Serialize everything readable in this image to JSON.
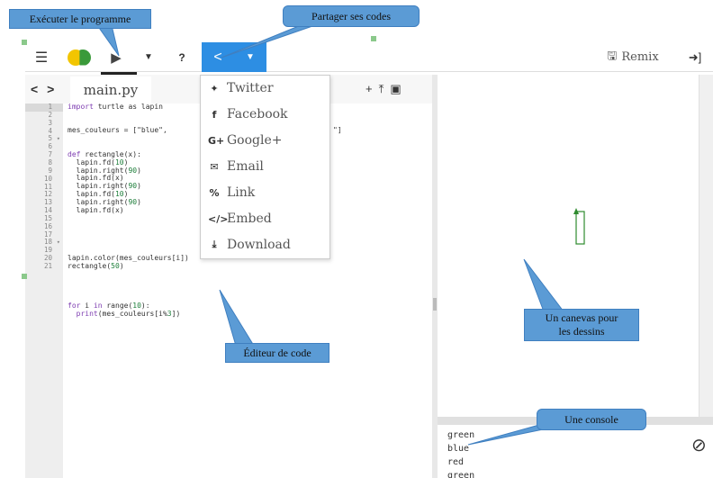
{
  "toolbar": {
    "menu_icon": "menu-icon",
    "run_icon": "play-icon",
    "help_label": "?",
    "remix_label": "Remix",
    "login_icon": "sign-in-icon"
  },
  "editor": {
    "filename": "main.py",
    "lines": [
      {
        "n": "1",
        "fold": ""
      },
      {
        "n": "2",
        "fold": ""
      },
      {
        "n": "3",
        "fold": ""
      },
      {
        "n": "4",
        "fold": ""
      },
      {
        "n": "5",
        "fold": "▾"
      },
      {
        "n": "6",
        "fold": ""
      },
      {
        "n": "7",
        "fold": ""
      },
      {
        "n": "8",
        "fold": ""
      },
      {
        "n": "9",
        "fold": ""
      },
      {
        "n": "10",
        "fold": ""
      },
      {
        "n": "11",
        "fold": ""
      },
      {
        "n": "12",
        "fold": ""
      },
      {
        "n": "13",
        "fold": ""
      },
      {
        "n": "14",
        "fold": ""
      },
      {
        "n": "15",
        "fold": ""
      },
      {
        "n": "16",
        "fold": ""
      },
      {
        "n": "17",
        "fold": ""
      },
      {
        "n": "18",
        "fold": "▾"
      },
      {
        "n": "19",
        "fold": ""
      },
      {
        "n": "20",
        "fold": ""
      },
      {
        "n": "21",
        "fold": ""
      }
    ],
    "code": {
      "l1_kw": "import",
      "l1_rest": " turtle as lapin",
      "l3": "mes_couleurs = [\"blue\",",
      "l3_tail": "\"]",
      "l5_kw": "def",
      "l5_rest": " rectangle(x):",
      "l6_a": "  lapin.fd(",
      "l6_n": "10",
      "l7_a": "  lapin.right(",
      "l7_n": "90",
      "l8": "  lapin.fd(x)",
      "l9_a": "  lapin.right(",
      "l9_n": "90",
      "l10_a": "  lapin.fd(",
      "l10_n": "10",
      "l11_a": "  lapin.right(",
      "l11_n": "90",
      "l12": "  lapin.fd(x)",
      "l14": "lapin.color(mes_couleurs[i])",
      "l15_a": "rectangle(",
      "l15_n": "50",
      "l18_kw": "for",
      "l18_b": " i ",
      "l18_kw2": "in",
      "l18_c": " range(",
      "l18_n": "10",
      "l18_d": "):",
      "l19_a": "  ",
      "l19_kw": "print",
      "l19_b": "(mes_couleurs[i%",
      "l19_n": "3",
      "l19_c": "])"
    }
  },
  "share_menu": {
    "items": [
      {
        "icon": "twitter-icon",
        "glyph": "🐦",
        "label": "Twitter"
      },
      {
        "icon": "facebook-icon",
        "glyph": "f",
        "label": "Facebook"
      },
      {
        "icon": "google-plus-icon",
        "glyph": "G+",
        "label": "Google+"
      },
      {
        "icon": "email-icon",
        "glyph": "✉",
        "label": "Email"
      },
      {
        "icon": "link-icon",
        "glyph": "🔗",
        "label": "Link"
      },
      {
        "icon": "embed-icon",
        "glyph": "</>",
        "label": "Embed"
      },
      {
        "icon": "download-icon",
        "glyph": "⤓",
        "label": "Download"
      }
    ]
  },
  "console": {
    "lines": [
      "green",
      "blue",
      "red",
      "green"
    ]
  },
  "annotations": {
    "run": "Exécuter le programme",
    "share": "Partager ses codes",
    "editor": "Éditeur de code",
    "canvas": "Un canevas pour les dessins",
    "console": "Une console"
  },
  "colors": {
    "accent": "#2d8ee3",
    "callout": "#5b9bd5",
    "turtle": "#2e8b2e"
  }
}
